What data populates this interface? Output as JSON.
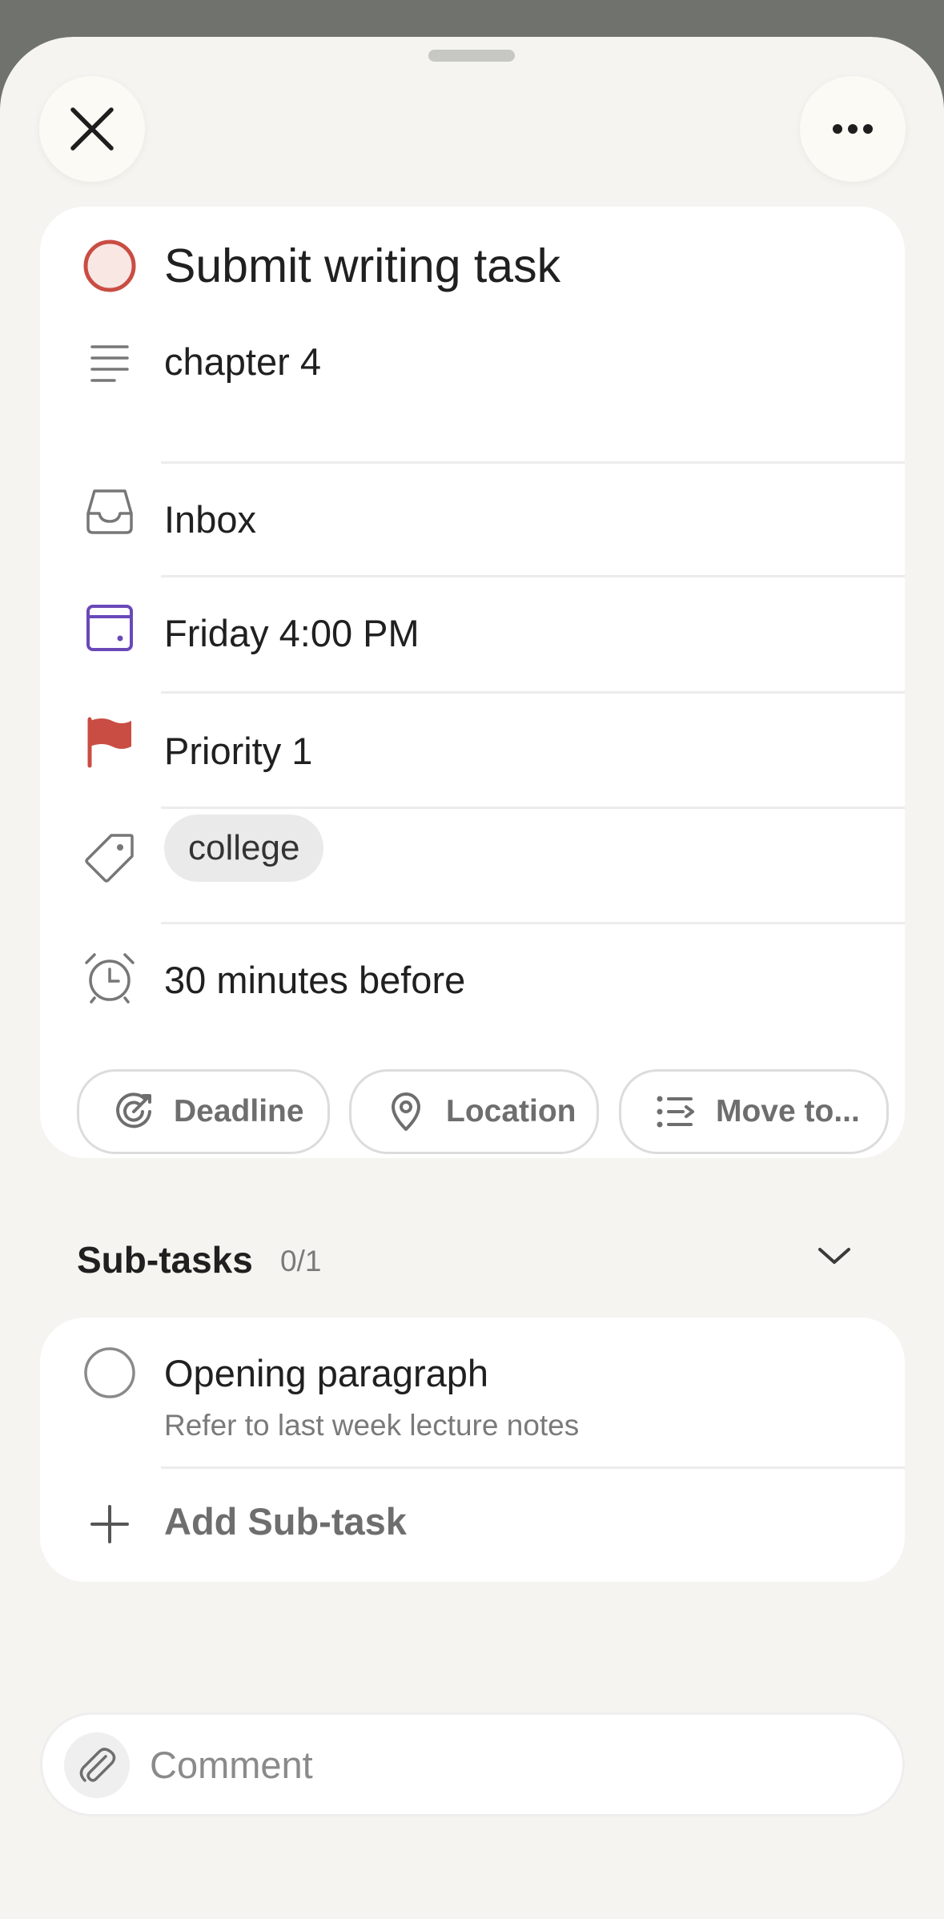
{
  "header": {
    "close_icon": "close-icon",
    "more_icon": "more-horizontal-icon"
  },
  "task": {
    "title": "Submit writing task",
    "priority_color": "#c94d43",
    "rows": {
      "description": "chapter 4",
      "project": "Inbox",
      "date": "Friday 4:00 PM",
      "priority": "Priority 1",
      "label": "college",
      "reminder": "30 minutes before"
    },
    "actions": {
      "deadline": "Deadline",
      "location": "Location",
      "move": "Move to..."
    }
  },
  "subtasks": {
    "heading": "Sub-tasks",
    "count": "0/1",
    "items": [
      {
        "title": "Opening paragraph",
        "note": "Refer to last week lecture notes"
      }
    ],
    "add_label": "Add Sub-task"
  },
  "comment": {
    "placeholder": "Comment"
  },
  "colors": {
    "calendar_accent": "#6a48b8",
    "flag": "#c94d43"
  }
}
